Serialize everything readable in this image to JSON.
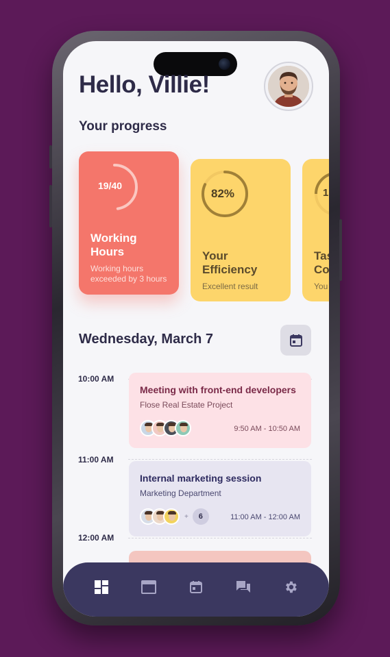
{
  "greeting": "Hello, Villie!",
  "progress": {
    "title": "Your progress",
    "cards": [
      {
        "ring_value": "19/40",
        "ring_fraction": 0.475,
        "title_line1": "Working",
        "title_line2": "Hours",
        "sub_line1": "Working hours",
        "sub_line2": "exceeded by 3 hours",
        "color": "#f4766b"
      },
      {
        "ring_value": "82%",
        "ring_fraction": 0.82,
        "title_line1": "Your",
        "title_line2": "Efficiency",
        "sub_line1": "Excellent result",
        "color": "#fdd56b"
      },
      {
        "ring_value": "1",
        "title_line1": "Tas",
        "title_line2": "Co",
        "sub_line1": "You",
        "color": "#fdd56b"
      }
    ]
  },
  "schedule": {
    "date": "Wednesday, March 7",
    "times": [
      "10:00 AM",
      "11:00 AM",
      "12:00 AM"
    ],
    "events": [
      {
        "title": "Meeting with front-end developers",
        "subtitle": "Flose Real Estate Project",
        "time": "9:50 AM - 10:50 AM",
        "color": "#fde1e6",
        "title_color": "#7a2a48"
      },
      {
        "title": "Internal marketing session",
        "subtitle": "Marketing Department",
        "time": "11:00 AM - 12:00 AM",
        "extra_count": "6",
        "plus": "+",
        "color": "#e7e5f1",
        "title_color": "#2e2b60"
      }
    ]
  },
  "nav": {
    "items": [
      "dashboard-icon",
      "window-icon",
      "calendar-icon",
      "chat-icon",
      "settings-icon"
    ],
    "active": "dashboard-icon"
  }
}
